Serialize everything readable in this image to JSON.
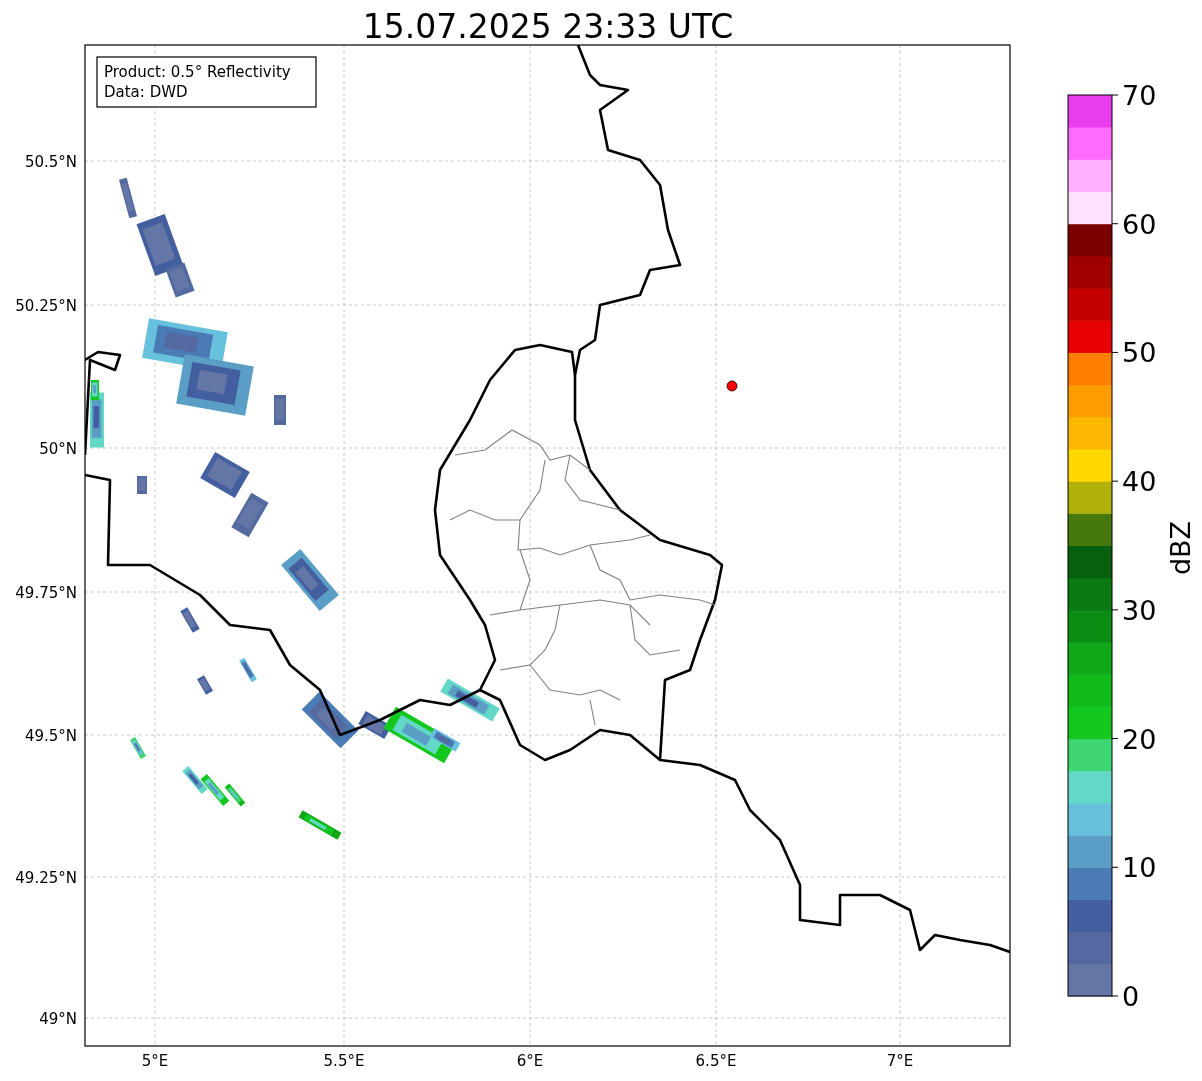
{
  "title": "15.07.2025 23:33 UTC",
  "info_box": [
    "Product: 0.5° Reflectivity",
    "Data: DWD"
  ],
  "map": {
    "lat_ticks": [
      "50.5°N",
      "50.25°N",
      "50°N",
      "49.75°N",
      "49.5°N",
      "49.25°N",
      "49°N"
    ],
    "lon_ticks": [
      "5°E",
      "5.5°E",
      "6°E",
      "6.5°E",
      "7°E"
    ]
  },
  "colorbar": {
    "label": "dBZ",
    "ticks": [
      "70",
      "60",
      "50",
      "40",
      "30",
      "20",
      "10",
      "0"
    ],
    "bands": [
      {
        "color": "#6476a6"
      },
      {
        "color": "#5469a0"
      },
      {
        "color": "#435fa0"
      },
      {
        "color": "#4a7bb5"
      },
      {
        "color": "#5a9ec6"
      },
      {
        "color": "#67c1dc"
      },
      {
        "color": "#63d8c6"
      },
      {
        "color": "#3ed672"
      },
      {
        "color": "#12c81e"
      },
      {
        "color": "#10ba1b"
      },
      {
        "color": "#0fa716"
      },
      {
        "color": "#0d8c14"
      },
      {
        "color": "#0a7a12"
      },
      {
        "color": "#06600f"
      },
      {
        "color": "#45790c"
      },
      {
        "color": "#b0b10a"
      },
      {
        "color": "#ffd800"
      },
      {
        "color": "#ffb800"
      },
      {
        "color": "#ff9c00"
      },
      {
        "color": "#ff7e00"
      },
      {
        "color": "#e60000"
      },
      {
        "color": "#c40000"
      },
      {
        "color": "#a00000"
      },
      {
        "color": "#7b0000"
      },
      {
        "color": "#ffe0ff"
      },
      {
        "color": "#ffb0ff"
      },
      {
        "color": "#ff6aff"
      },
      {
        "color": "#e83cee"
      }
    ]
  }
}
